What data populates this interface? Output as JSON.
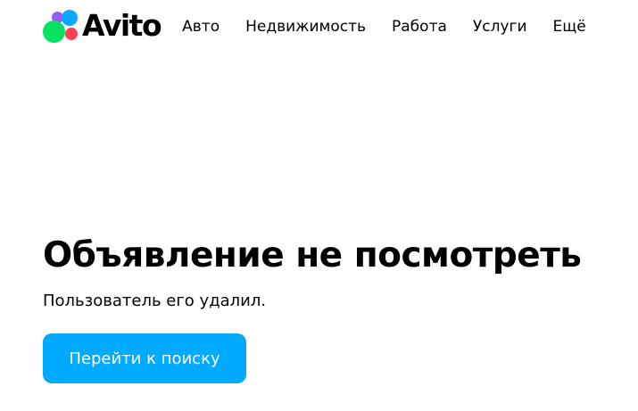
{
  "brand": {
    "name": "Avito",
    "colors": {
      "purple": "#965eeb",
      "blue": "#0aa7ff",
      "green": "#04e061",
      "red": "#ff4053"
    }
  },
  "nav": {
    "items": [
      {
        "label": "Авто"
      },
      {
        "label": "Недвижимость"
      },
      {
        "label": "Работа"
      },
      {
        "label": "Услуги"
      },
      {
        "label": "Ещё"
      }
    ]
  },
  "main": {
    "title": "Объявление не посмотреть",
    "subtitle": "Пользователь его удалил.",
    "button_label": "Перейти к поиску",
    "button_color": "#00aaff"
  }
}
